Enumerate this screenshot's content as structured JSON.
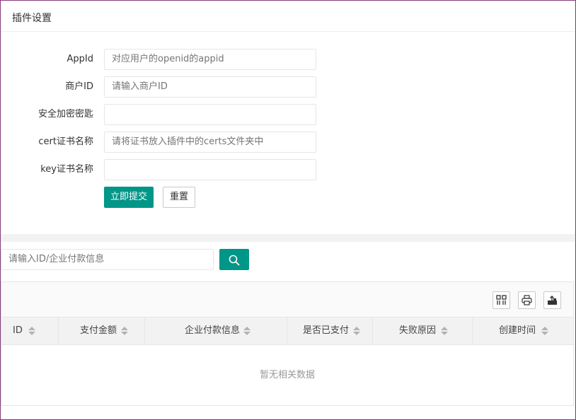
{
  "panel": {
    "title": "插件设置"
  },
  "form": {
    "fields": [
      {
        "label": "AppId",
        "value": "",
        "placeholder": "对应用户的openid的appid"
      },
      {
        "label": "商户ID",
        "value": "",
        "placeholder": "请输入商户ID"
      },
      {
        "label": "安全加密密匙",
        "value": "",
        "placeholder": ""
      },
      {
        "label": "cert证书名称",
        "value": "",
        "placeholder": "请将证书放入插件中的certs文件夹中"
      },
      {
        "label": "key证书名称",
        "value": "",
        "placeholder": ""
      }
    ],
    "submit_label": "立即提交",
    "reset_label": "重置"
  },
  "search": {
    "placeholder": "请输入ID/企业付款信息",
    "value": ""
  },
  "toolbar": {
    "icons": [
      "columns-filter-icon",
      "print-icon",
      "export-icon"
    ]
  },
  "table": {
    "columns": [
      "ID",
      "支付金额",
      "企业付款信息",
      "是否已支付",
      "失败原因",
      "创建时间"
    ],
    "rows": [],
    "empty_text": "暂无相关数据"
  },
  "colors": {
    "primary": "#009688",
    "frame": "#8a3a7a"
  }
}
